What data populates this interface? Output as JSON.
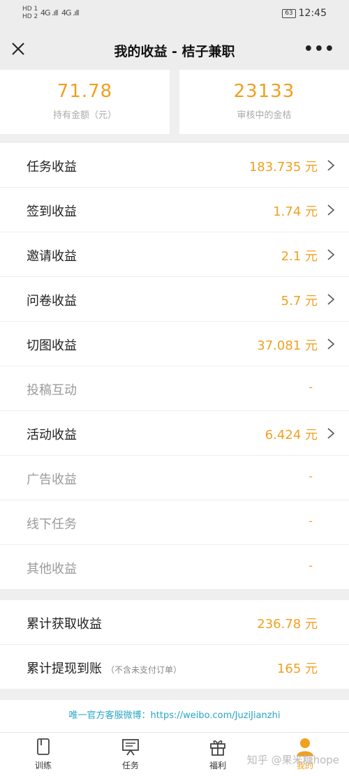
{
  "status_bar": {
    "left_top": "HD 1",
    "left_bottom": "HD 2",
    "signal1": "4G .ıll",
    "signal2": "4G .ıll",
    "battery": "63",
    "time": "12:45"
  },
  "header": {
    "title": "我的收益 - 桔子兼职"
  },
  "summary": {
    "held_amount": "71.78",
    "held_label": "持有金额（元）",
    "pending_amount": "23133",
    "pending_label": "审核中的金桔"
  },
  "income_rows": [
    {
      "label": "任务收益",
      "value": "183.735 元",
      "has_arrow": true
    },
    {
      "label": "签到收益",
      "value": "1.74 元",
      "has_arrow": true
    },
    {
      "label": "邀请收益",
      "value": "2.1 元",
      "has_arrow": true
    },
    {
      "label": "问卷收益",
      "value": "5.7 元",
      "has_arrow": true
    },
    {
      "label": "切图收益",
      "value": "37.081 元",
      "has_arrow": true
    },
    {
      "label": "投稿互动",
      "value": "-",
      "has_arrow": false
    },
    {
      "label": "活动收益",
      "value": "6.424 元",
      "has_arrow": true
    },
    {
      "label": "广告收益",
      "value": "-",
      "has_arrow": false
    },
    {
      "label": "线下任务",
      "value": "-",
      "has_arrow": false
    },
    {
      "label": "其他收益",
      "value": "-",
      "has_arrow": false
    }
  ],
  "totals": {
    "earned_label": "累计获取收益",
    "earned_value": "236.78 元",
    "withdrawn_label": "累计提现到账",
    "withdrawn_note": "（不含未支付订单）",
    "withdrawn_value": "165 元"
  },
  "footer_link": "唯一官方客服微博：https://weibo.com/JuziJianzhi",
  "tabs": [
    {
      "label": "训练",
      "icon": "book-icon"
    },
    {
      "label": "任务",
      "icon": "presentation-icon"
    },
    {
      "label": "福利",
      "icon": "gift-icon"
    },
    {
      "label": "我的",
      "icon": "person-icon"
    }
  ],
  "watermark": "知乎 @果米糖hope",
  "colors": {
    "accent": "#f0a020",
    "link": "#27a6c6",
    "background": "#efefef"
  }
}
